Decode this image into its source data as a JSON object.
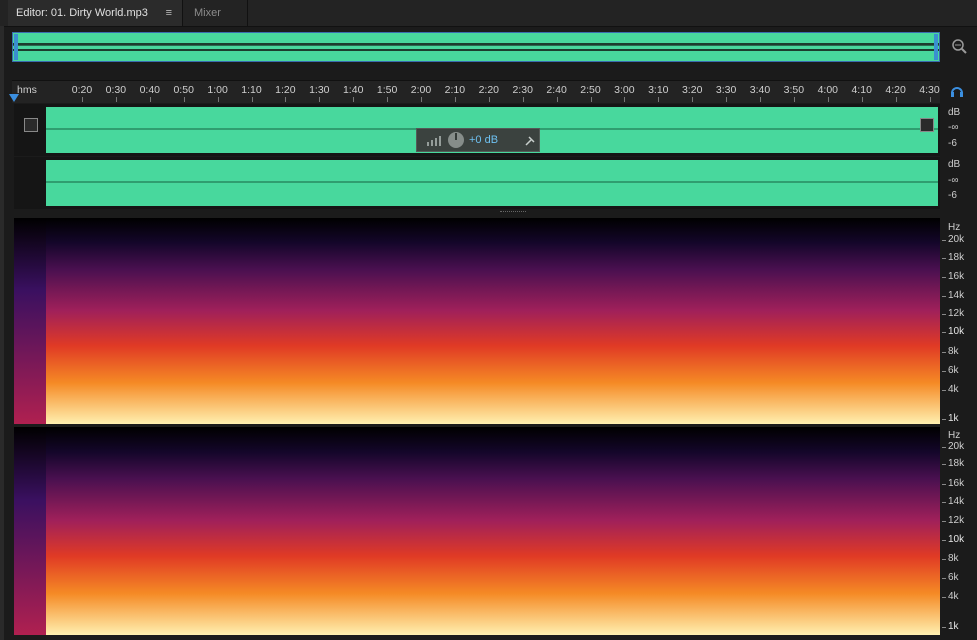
{
  "tabs": {
    "editor_label": "Editor: 01. Dirty World.mp3",
    "editor_menu_icon": "≡",
    "mixer_label": "Mixer"
  },
  "ruler": {
    "unit_label": "hms",
    "ticks": [
      "0:20",
      "0:30",
      "0:40",
      "0:50",
      "1:00",
      "1:10",
      "1:20",
      "1:30",
      "1:40",
      "1:50",
      "2:00",
      "2:10",
      "2:20",
      "2:30",
      "2:40",
      "2:50",
      "3:00",
      "3:10",
      "3:20",
      "3:30",
      "3:40",
      "3:50",
      "4:00",
      "4:10",
      "4:20",
      "4:30"
    ]
  },
  "hud": {
    "volume": "+0 dB"
  },
  "waveform": {
    "channel1": {
      "db_unit": "dB",
      "db_inf": "-∞",
      "db_minus6": "-6"
    },
    "channel2": {
      "db_unit": "dB",
      "db_inf": "-∞",
      "db_minus6": "-6"
    }
  },
  "spectral": {
    "hz_labels": [
      "Hz",
      "20k",
      "18k",
      "16k",
      "14k",
      "12k",
      "10k",
      "8k",
      "6k",
      "4k",
      "1k"
    ]
  },
  "colors": {
    "waveform": "#48d89d",
    "accent": "#3b8fe0",
    "background": "#1b1b1b"
  }
}
